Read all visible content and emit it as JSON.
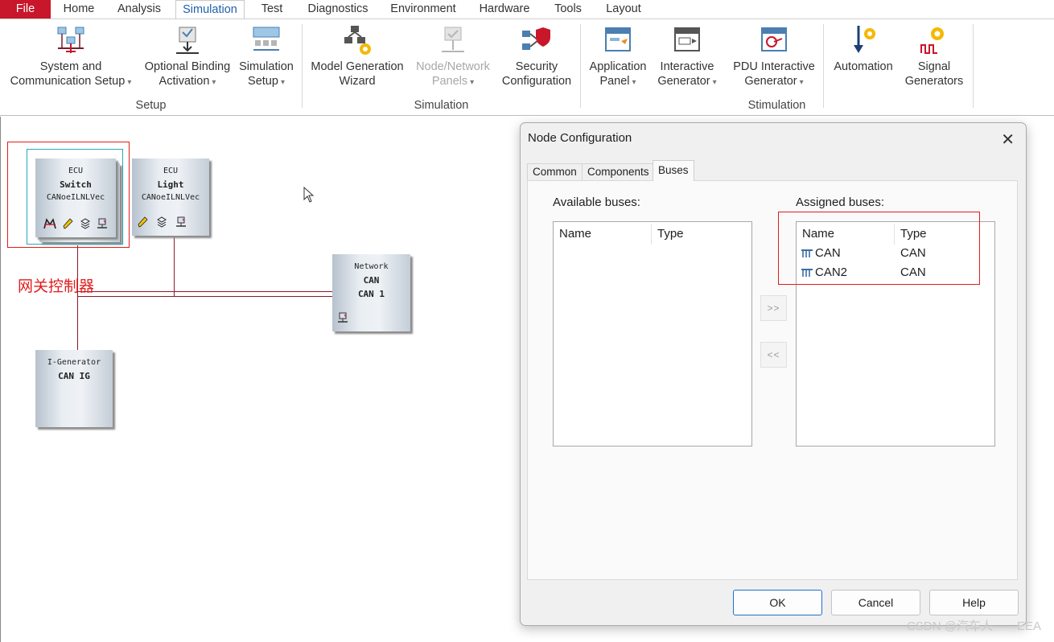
{
  "ribbon_tabs": [
    "File",
    "Home",
    "Analysis",
    "Simulation",
    "Test",
    "Diagnostics",
    "Environment",
    "Hardware",
    "Tools",
    "Layout"
  ],
  "ribbon": {
    "setup": {
      "system_comm_l1": "System and",
      "system_comm_l2": "Communication Setup",
      "optional_binding_l1": "Optional Binding",
      "optional_binding_l2": "Activation",
      "sim_setup_l1": "Simulation",
      "sim_setup_l2": "Setup",
      "group": "Setup"
    },
    "simulation": {
      "model_gen_l1": "Model Generation",
      "model_gen_l2": "Wizard",
      "node_panels_l1": "Node/Network",
      "node_panels_l2": "Panels",
      "security_l1": "Security",
      "security_l2": "Configuration",
      "group": "Simulation"
    },
    "stimulation": {
      "app_panel_l1": "Application",
      "app_panel_l2": "Panel",
      "interactive_gen_l1": "Interactive",
      "interactive_gen_l2": "Generator",
      "pdu_gen_l1": "PDU Interactive",
      "pdu_gen_l2": "Generator",
      "automation": "Automation",
      "signal_gen_l1": "Signal",
      "signal_gen_l2": "Generators",
      "group": "Stimulation"
    }
  },
  "canvas": {
    "nodes": {
      "switch": {
        "l1": "ECU",
        "l2": "Switch",
        "l3": "CANoeILNLVec"
      },
      "light": {
        "l1": "ECU",
        "l2": "Light",
        "l3": "CANoeILNLVec"
      },
      "network": {
        "l1": "Network",
        "l2": "CAN",
        "l3": "CAN 1"
      },
      "igen": {
        "l1": "I-Generator",
        "l2": "CAN IG"
      }
    },
    "annotation": "网关控制器"
  },
  "dialog": {
    "title": "Node Configuration",
    "tabs": [
      "Common",
      "Components",
      "Buses"
    ],
    "active_tab": "Buses",
    "available_label": "Available buses:",
    "assigned_label": "Assigned buses:",
    "col_name": "Name",
    "col_type": "Type",
    "assigned": [
      {
        "name": "CAN",
        "type": "CAN"
      },
      {
        "name": "CAN2",
        "type": "CAN"
      }
    ],
    "add_btn": ">>",
    "remove_btn": "<<",
    "ok": "OK",
    "cancel": "Cancel",
    "help": "Help"
  },
  "watermark": "CSDN @汽车人——EEA",
  "colors": {
    "accent": "#1f5fae",
    "file_tab": "#c8162b",
    "highlight": "#e21b1b",
    "wire": "#8b1a2a"
  }
}
